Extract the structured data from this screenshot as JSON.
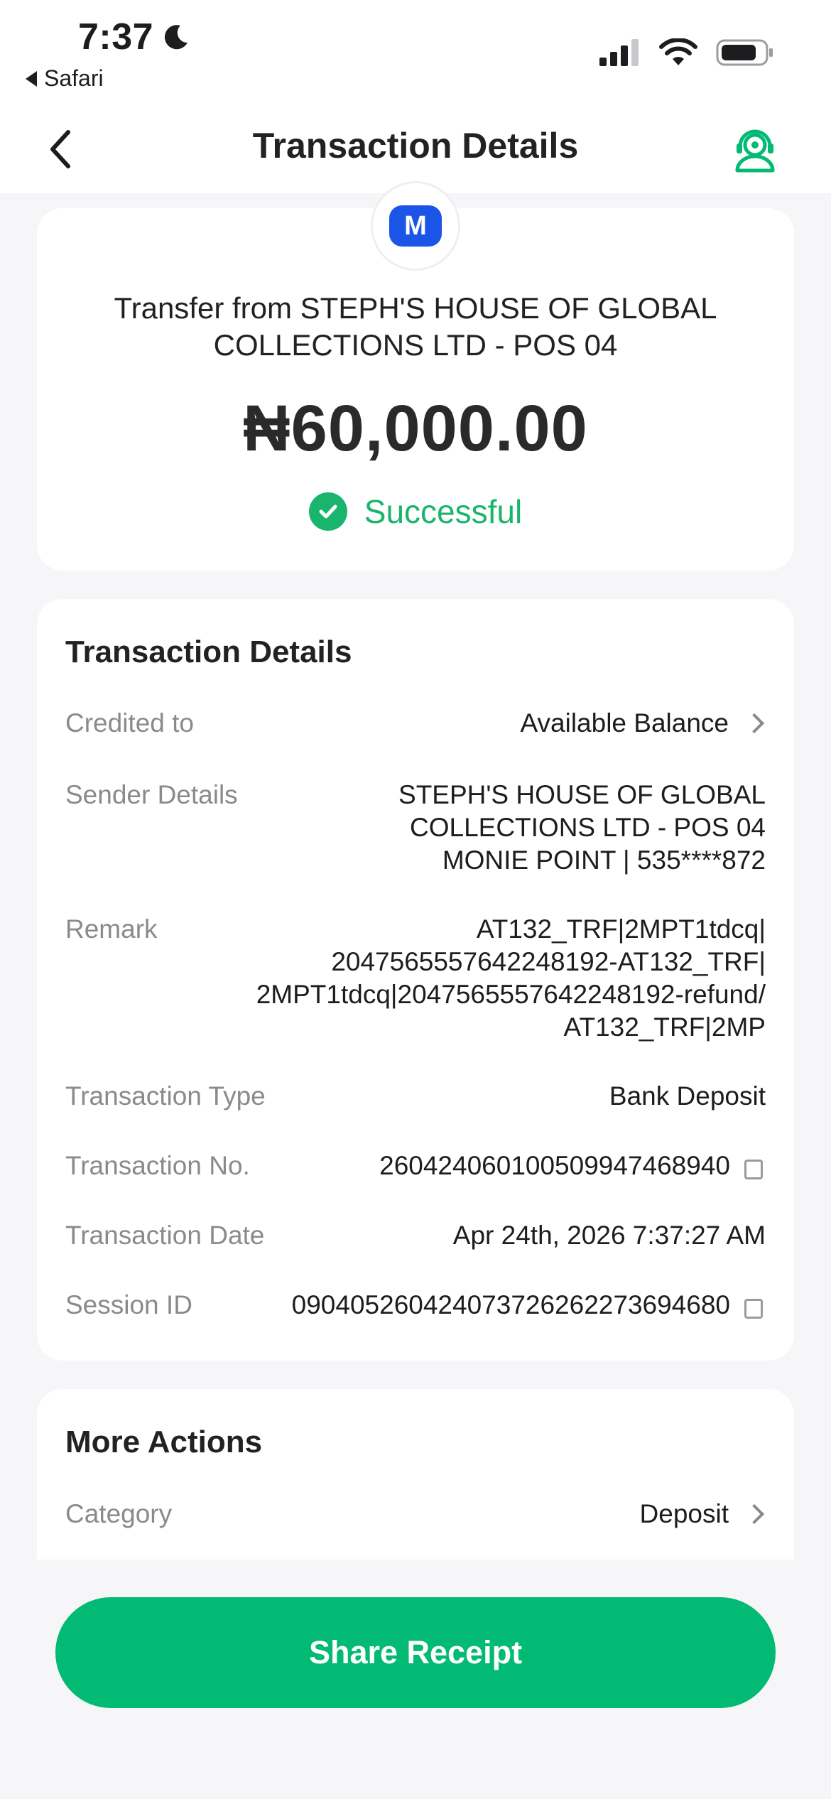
{
  "status_bar": {
    "time": "7:37",
    "back_app": "Safari"
  },
  "header": {
    "title": "Transaction Details"
  },
  "summary": {
    "logo_letter": "M",
    "title": "Transfer from STEPH'S HOUSE OF GLOBAL COLLECTIONS LTD - POS 04",
    "amount": "₦60,000.00",
    "status": "Successful",
    "status_color": "#1ab56d"
  },
  "details": {
    "section_title": "Transaction Details",
    "rows": [
      {
        "label": "Credited to",
        "value": "Available Balance"
      },
      {
        "label": "Sender Details",
        "value_lines": [
          "STEPH'S HOUSE OF GLOBAL",
          "COLLECTIONS LTD - POS 04",
          "MONIE POINT | 535****872"
        ]
      },
      {
        "label": "Remark",
        "value_lines": [
          "AT132_TRF|2MPT1tdcq|",
          "2047565557642248192-AT132_TRF|",
          "2MPT1tdcq|2047565557642248192-refund/",
          "AT132_TRF|2MP"
        ]
      },
      {
        "label": "Transaction Type",
        "value": "Bank Deposit"
      },
      {
        "label": "Transaction No.",
        "value": "260424060100509947468940"
      },
      {
        "label": "Transaction Date",
        "value": "Apr 24th, 2026 7:37:27 AM"
      },
      {
        "label": "Session ID",
        "value": "090405260424073726262273694680"
      }
    ]
  },
  "more_actions": {
    "section_title": "More Actions",
    "category_label": "Category",
    "category_value": "Deposit"
  },
  "share_button": {
    "label": "Share Receipt",
    "color": "#02ba73"
  }
}
